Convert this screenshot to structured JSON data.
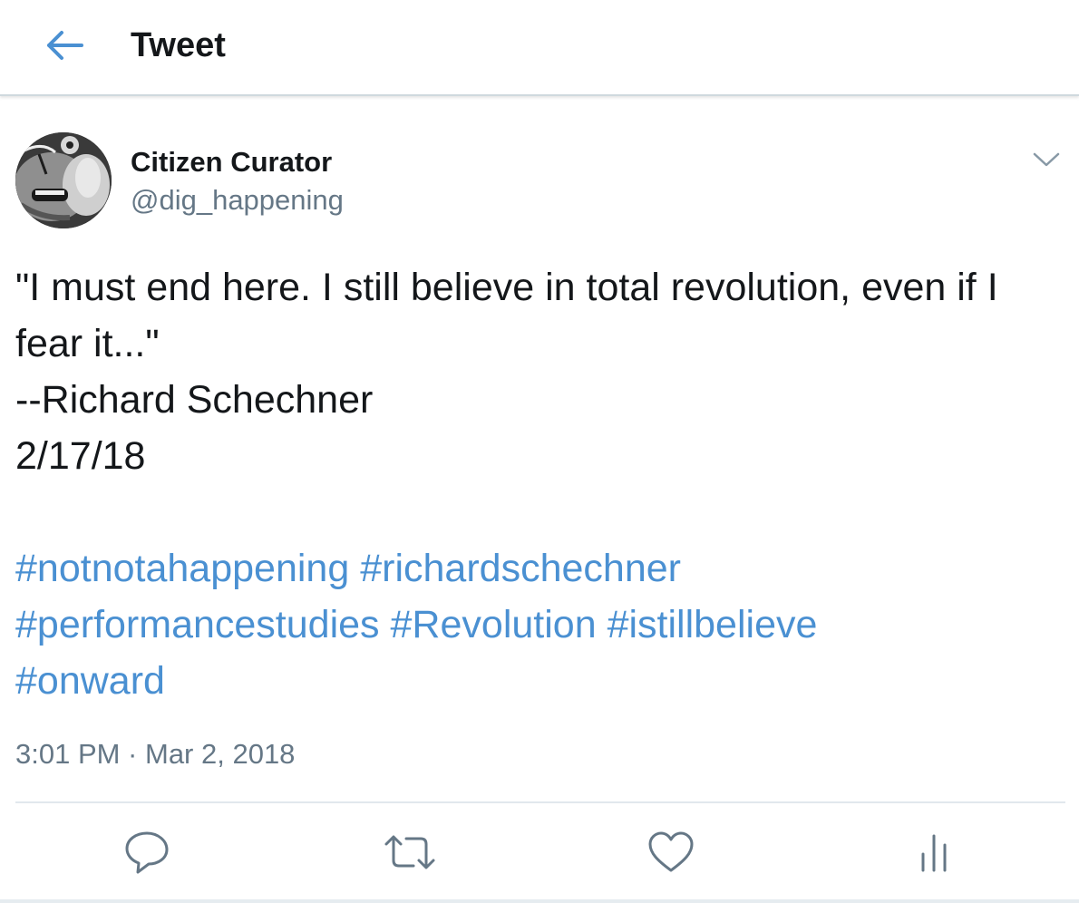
{
  "header": {
    "title": "Tweet",
    "back_icon": "back-arrow-icon"
  },
  "colors": {
    "accent": "#4a90d2",
    "text": "#14171a",
    "secondary_text": "#657786",
    "divider": "#e1e8ed"
  },
  "tweet": {
    "author": {
      "name": "Citizen Curator",
      "handle": "@dig_happening"
    },
    "text_lines": [
      "\"I must end here. I still believe in total revolution, even if I",
      "fear it...\"",
      "--Richard Schechner",
      "2/17/18"
    ],
    "hashtags": [
      "#notnotahappening",
      "#richardschechner",
      "#performancestudies",
      "#Revolution",
      "#istillbelieve",
      "#onward"
    ],
    "timestamp": "3:01 PM · Mar 2, 2018"
  },
  "actions": [
    {
      "name": "reply",
      "icon": "reply-icon"
    },
    {
      "name": "retweet",
      "icon": "retweet-icon"
    },
    {
      "name": "like",
      "icon": "heart-icon"
    },
    {
      "name": "analytics",
      "icon": "analytics-icon"
    }
  ]
}
